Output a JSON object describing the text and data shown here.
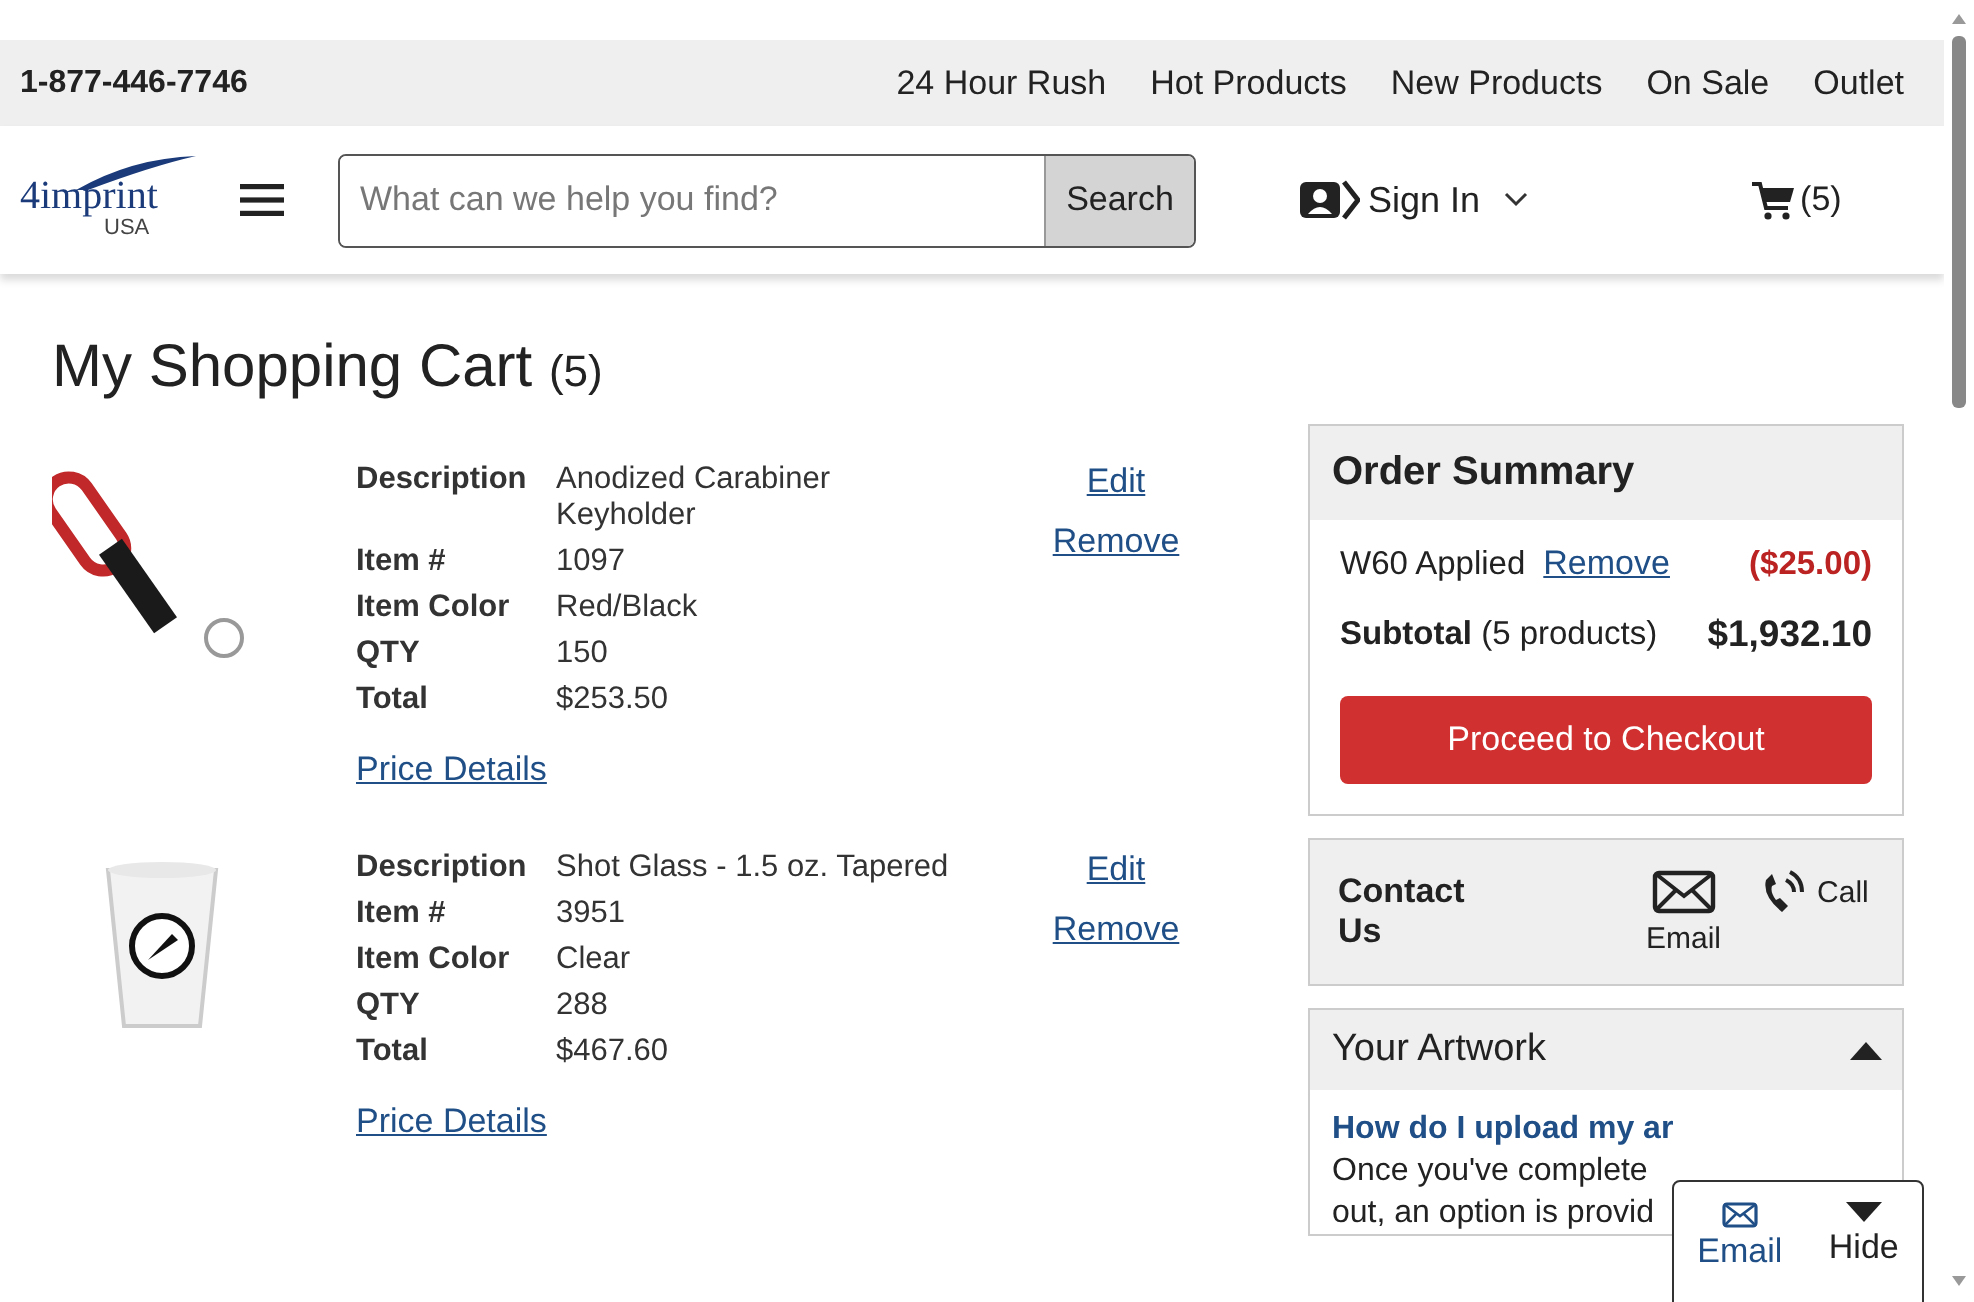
{
  "utility_bar": {
    "phone": "1-877-446-7746",
    "links": [
      "24 Hour Rush",
      "Hot Products",
      "New Products",
      "On Sale",
      "Outlet"
    ]
  },
  "header": {
    "logo": {
      "brand": "4imprint",
      "region": "USA"
    },
    "search": {
      "placeholder": "What can we help you find?",
      "button": "Search"
    },
    "sign_in": "Sign In",
    "cart_count": "(5)"
  },
  "page": {
    "title": "My Shopping Cart",
    "count": "(5)"
  },
  "cart_items": [
    {
      "kind": "picture",
      "fields": [
        {
          "label": "Description",
          "value": "Anodized Carabiner Keyholder"
        },
        {
          "label": "Item #",
          "value": "1097"
        },
        {
          "label": "Item Color",
          "value": "Red/Black"
        },
        {
          "label": "QTY",
          "value": "150"
        },
        {
          "label": "Total",
          "value": "$253.50"
        }
      ],
      "price_details": "Price Details",
      "edit": "Edit",
      "remove": "Remove"
    },
    {
      "kind": "picture",
      "fields": [
        {
          "label": "Description",
          "value": "Shot Glass - 1.5 oz. Tapered"
        },
        {
          "label": "Item #",
          "value": "3951"
        },
        {
          "label": "Item Color",
          "value": "Clear"
        },
        {
          "label": "QTY",
          "value": "288"
        },
        {
          "label": "Total",
          "value": "$467.60"
        }
      ],
      "price_details": "Price Details",
      "edit": "Edit",
      "remove": "Remove"
    }
  ],
  "order_summary": {
    "title": "Order Summary",
    "discount": {
      "label": "W60 Applied",
      "remove": "Remove",
      "amount": "($25.00)"
    },
    "subtotal": {
      "label": "Subtotal",
      "note": "(5 products)",
      "amount": "$1,932.10"
    },
    "checkout": "Proceed to Checkout"
  },
  "contact": {
    "title": "Contact Us",
    "email": "Email",
    "call": "Call"
  },
  "artwork": {
    "title": "Your Artwork",
    "expanded": true,
    "question": "How do I upload my ar",
    "lines": [
      "Once you've complete",
      "out, an option is provid"
    ]
  },
  "chat_popup": {
    "email": "Email",
    "hide": "Hide"
  }
}
